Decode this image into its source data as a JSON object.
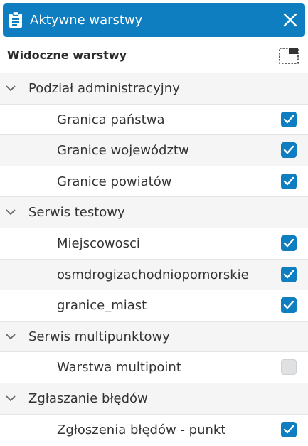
{
  "header": {
    "title": "Aktywne warstwy",
    "icon": "clipboard-icon",
    "close_icon": "close-icon",
    "color": "#0f7ec0"
  },
  "subheader": {
    "label": "Widoczne warstwy",
    "icon": "panel-toggle-icon"
  },
  "groups": [
    {
      "label": "Podział administracyjny",
      "layers": [
        {
          "label": "Granica państwa",
          "checked": true
        },
        {
          "label": "Granice województw",
          "checked": true
        },
        {
          "label": "Granice powiatów",
          "checked": true
        }
      ]
    },
    {
      "label": "Serwis testowy",
      "layers": [
        {
          "label": "Miejscowosci",
          "checked": true
        },
        {
          "label": "osmdrogizachodniopomorskie",
          "checked": true
        },
        {
          "label": "granice_miast",
          "checked": true
        }
      ]
    },
    {
      "label": "Serwis multipunktowy",
      "layers": [
        {
          "label": "Warstwa multipoint",
          "checked": false
        }
      ]
    },
    {
      "label": "Zgłaszanie błędów",
      "layers": [
        {
          "label": "Zgłoszenia błędów - punkt",
          "checked": true
        }
      ]
    }
  ]
}
